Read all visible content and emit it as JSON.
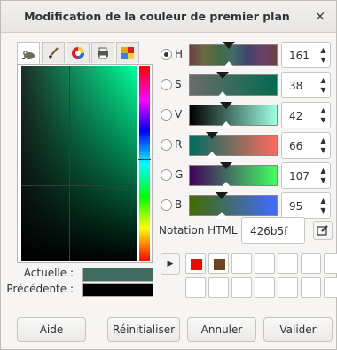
{
  "window": {
    "title": "Modification de la couleur de premier plan",
    "close_label": "×"
  },
  "tabs": [
    {
      "icon": "gimp-wilber-icon",
      "active": true
    },
    {
      "icon": "paintbrush-icon",
      "active": false
    },
    {
      "icon": "color-wheel-icon",
      "active": false
    },
    {
      "icon": "printer-icon",
      "active": false
    },
    {
      "icon": "palette-icon",
      "active": false
    }
  ],
  "comparison": {
    "current_label": "Actuelle :",
    "previous_label": "Précédente :",
    "current_color": "#426b5f",
    "previous_color": "#000000"
  },
  "channels": [
    {
      "letter": "H",
      "value": "161",
      "selected": true,
      "level": 0.447,
      "gradient": "linear-gradient(to right,#6b4242,#6b6b42,#426b42,#426b6b,#42426b,#6b426b,#6b4242)"
    },
    {
      "letter": "S",
      "value": "38",
      "selected": false,
      "level": 0.38,
      "gradient": "linear-gradient(to right,#6b6b6b,#006b4e)"
    },
    {
      "letter": "V",
      "value": "42",
      "selected": false,
      "level": 0.42,
      "gradient": "linear-gradient(to right,#000000,#9effe2)"
    },
    {
      "letter": "R",
      "value": "66",
      "selected": false,
      "level": 0.259,
      "gradient": "linear-gradient(to right,#006b5f,#ff6b5f)"
    },
    {
      "letter": "G",
      "value": "107",
      "selected": false,
      "level": 0.42,
      "gradient": "linear-gradient(to right,#42005f,#42ff5f)"
    },
    {
      "letter": "B",
      "value": "95",
      "selected": false,
      "level": 0.373,
      "gradient": "linear-gradient(to right,#426b00,#426bff)"
    }
  ],
  "html_notation": {
    "label": "Notation HTML :",
    "value": "426b5f"
  },
  "history": {
    "colors": [
      "#ff0000",
      "#6b4423",
      "",
      "",
      "",
      "",
      "",
      "",
      "",
      "",
      "",
      "",
      "",
      ""
    ]
  },
  "buttons": {
    "help": "Aide",
    "reset": "Réinitialiser",
    "cancel": "Annuler",
    "ok": "Valider"
  }
}
